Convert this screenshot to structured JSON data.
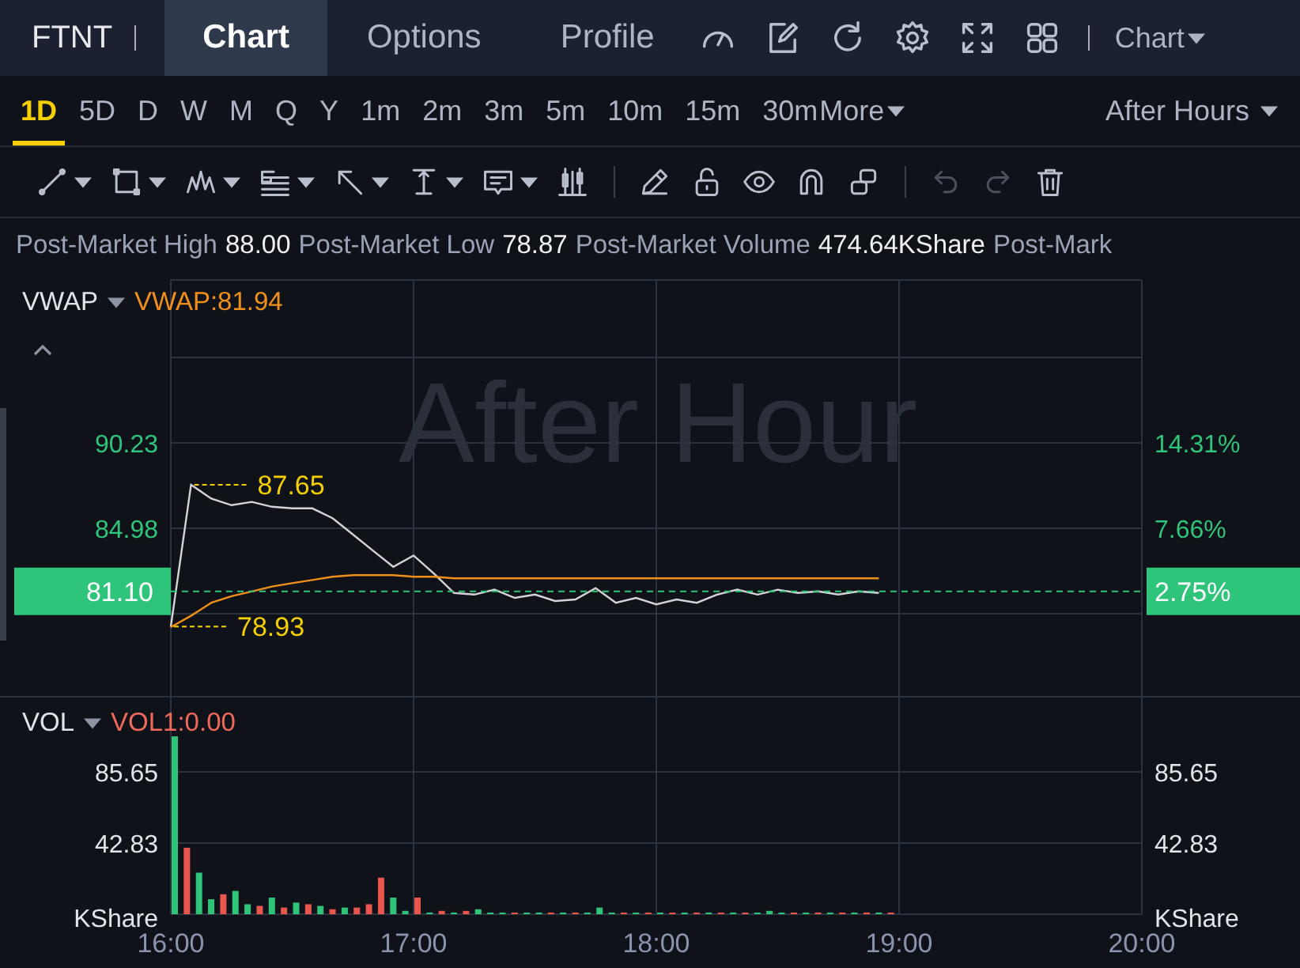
{
  "header": {
    "symbol": "FTNT",
    "tabs": [
      {
        "label": "Chart",
        "selected": true
      },
      {
        "label": "Options",
        "selected": false
      },
      {
        "label": "Profile",
        "selected": false
      }
    ],
    "tools": [
      {
        "kind": "gauge"
      },
      {
        "kind": "edit"
      },
      {
        "kind": "refresh"
      },
      {
        "kind": "settings"
      },
      {
        "kind": "fullscreen"
      },
      {
        "kind": "layout"
      }
    ],
    "chart_menu": "Chart"
  },
  "periods": [
    {
      "label": "1D",
      "selected": true
    },
    {
      "label": "5D",
      "selected": false
    },
    {
      "label": "D",
      "selected": false
    },
    {
      "label": "W",
      "selected": false
    },
    {
      "label": "M",
      "selected": false
    },
    {
      "label": "Q",
      "selected": false
    },
    {
      "label": "Y",
      "selected": false
    },
    {
      "label": "1m",
      "selected": false
    },
    {
      "label": "2m",
      "selected": false
    },
    {
      "label": "3m",
      "selected": false
    },
    {
      "label": "5m",
      "selected": false
    },
    {
      "label": "10m",
      "selected": false
    },
    {
      "label": "15m",
      "selected": false
    },
    {
      "label": "30m",
      "selected": false
    }
  ],
  "more_menu": "More",
  "session_menu": "After Hours",
  "drawing_tools": [
    {
      "kind": "line",
      "menu": true,
      "disabled": false
    },
    {
      "kind": "rectangle",
      "menu": true,
      "disabled": false
    },
    {
      "kind": "pattern",
      "menu": true,
      "disabled": false
    },
    {
      "kind": "fib",
      "menu": true,
      "disabled": false
    },
    {
      "kind": "arrow",
      "menu": true,
      "disabled": false
    },
    {
      "kind": "measure",
      "menu": true,
      "disabled": false
    },
    {
      "kind": "textbox",
      "menu": true,
      "disabled": false
    },
    {
      "kind": "candles",
      "menu": false,
      "disabled": false
    },
    {
      "kind": "divider"
    },
    {
      "kind": "pencil",
      "menu": false,
      "disabled": false
    },
    {
      "kind": "lock",
      "menu": false,
      "disabled": false
    },
    {
      "kind": "eye",
      "menu": false,
      "disabled": false
    },
    {
      "kind": "magnet",
      "menu": false,
      "disabled": false
    },
    {
      "kind": "link",
      "menu": false,
      "disabled": false
    },
    {
      "kind": "divider"
    },
    {
      "kind": "undo",
      "menu": false,
      "disabled": true
    },
    {
      "kind": "redo",
      "menu": false,
      "disabled": true
    },
    {
      "kind": "trash",
      "menu": false,
      "disabled": false
    }
  ],
  "stats": [
    {
      "label": "Post-Market High",
      "value": "88.00"
    },
    {
      "label": "Post-Market Low",
      "value": "78.87"
    },
    {
      "label": "Post-Market Volume",
      "value": "474.64KShare"
    },
    {
      "label": "Post-Mark"
    }
  ],
  "price_pane": {
    "indicator": "VWAP",
    "reading": "VWAP:81.94",
    "watermark": "After Hour",
    "right_axis": [
      "14.31%",
      "7.66%"
    ],
    "last_change": "2.75%",
    "chart_data": {
      "type": "line",
      "categories": [
        null,
        null,
        null,
        null,
        null,
        null,
        null,
        null,
        null,
        null,
        null,
        null,
        null,
        null,
        null,
        null,
        null,
        null,
        null,
        null,
        null,
        null,
        null,
        null,
        null,
        null,
        null,
        null,
        null,
        null,
        null,
        null,
        null,
        null,
        null,
        null,
        null,
        null,
        null,
        null,
        null,
        null,
        null,
        null,
        null,
        null,
        null,
        null,
        null
      ],
      "series": [
        {
          "color": "#d4d4d4",
          "values": [
            78.93,
            87.65,
            86.8,
            86.4,
            86.6,
            86.3,
            86.2,
            86.2,
            85.6,
            84.6,
            83.6,
            82.6,
            83.3,
            82.2,
            81.0,
            80.9,
            81.2,
            80.7,
            80.9,
            80.5,
            80.6,
            81.3,
            80.4,
            80.7,
            80.3,
            80.6,
            80.4,
            80.9,
            81.2,
            80.9,
            81.2,
            81.0,
            81.1,
            80.9,
            81.1,
            81.0,
            null,
            null,
            null,
            null,
            null,
            null,
            null,
            null,
            null,
            null,
            null,
            null,
            null
          ]
        },
        {
          "color": "#f0901a",
          "values": [
            78.9,
            79.6,
            80.4,
            80.8,
            81.1,
            81.4,
            81.6,
            81.8,
            82.0,
            82.1,
            82.1,
            82.1,
            82.0,
            82.0,
            81.9,
            81.9,
            81.9,
            81.9,
            81.9,
            81.9,
            81.9,
            81.9,
            81.9,
            81.9,
            81.9,
            81.9,
            81.9,
            81.9,
            81.9,
            81.9,
            81.9,
            81.9,
            81.9,
            81.9,
            81.9,
            81.9,
            null,
            null,
            null,
            null,
            null,
            null,
            null,
            null,
            null,
            null,
            null,
            null,
            null
          ]
        }
      ],
      "ylim": [
        74.67,
        100.24
      ],
      "grid": true,
      "yticks": [
        {
          "value": 90.23,
          "label": "90.23"
        },
        {
          "value": 84.98,
          "label": "84.98"
        }
      ],
      "ref_lines": [
        {
          "axis": "y",
          "value": 81.1,
          "label": "81.10"
        }
      ],
      "annotations": [
        "87.65",
        "78.93"
      ]
    }
  },
  "volume_pane": {
    "indicator": "VOL",
    "reading": "VOL1:0.00",
    "right_axis": [
      "85.65",
      "42.83",
      "KShare"
    ],
    "chart_data": {
      "type": "bar",
      "ylabel": "KShare",
      "categories": [
        "16:00",
        null,
        null,
        null,
        null,
        null,
        null,
        null,
        null,
        null,
        null,
        null,
        null,
        null,
        null,
        null,
        null,
        null,
        null,
        null,
        "17:00",
        null,
        null,
        null,
        null,
        null,
        null,
        null,
        null,
        null,
        null,
        null,
        null,
        null,
        null,
        null,
        null,
        null,
        null,
        null,
        "18:00",
        null,
        null,
        null,
        null,
        null,
        null,
        null,
        null,
        null,
        null,
        null,
        null,
        null,
        null,
        null,
        null,
        null,
        null,
        null,
        "19:00",
        null,
        null,
        null,
        null,
        null,
        null,
        null,
        null,
        null,
        null,
        null,
        null,
        null,
        null,
        null,
        null,
        null,
        null,
        null,
        "20:00"
      ],
      "series": [
        {
          "color": "#2ec47a",
          "values": [
            107,
            null,
            25,
            9,
            null,
            14,
            6,
            null,
            10,
            null,
            7,
            null,
            5,
            null,
            4,
            null,
            null,
            null,
            10,
            2,
            null,
            1,
            null,
            1,
            null,
            3,
            1,
            1,
            null,
            1,
            1,
            null,
            1,
            null,
            1,
            4,
            1,
            null,
            1,
            null,
            1,
            null,
            1,
            null,
            1,
            null,
            1,
            null,
            1,
            2,
            1,
            null,
            1,
            null,
            1,
            null,
            1,
            null,
            1,
            null,
            null,
            null,
            null,
            null,
            null,
            null,
            null,
            null,
            null,
            null,
            null,
            null,
            null,
            null,
            null,
            null,
            null,
            null,
            null,
            null,
            null
          ]
        },
        {
          "color": "#e8564e",
          "values": [
            null,
            40,
            null,
            null,
            12,
            null,
            null,
            5,
            null,
            4,
            null,
            6,
            null,
            3,
            null,
            4,
            6,
            22,
            null,
            null,
            10,
            null,
            2,
            null,
            2,
            null,
            null,
            null,
            1,
            null,
            null,
            1,
            null,
            1,
            null,
            null,
            null,
            1,
            null,
            1,
            null,
            1,
            null,
            1,
            null,
            1,
            null,
            1,
            null,
            null,
            null,
            1,
            null,
            1,
            null,
            1,
            null,
            1,
            null,
            1,
            null,
            null,
            null,
            null,
            null,
            null,
            null,
            null,
            null,
            null,
            null,
            null,
            null,
            null,
            null,
            null,
            null,
            null,
            null,
            null,
            null
          ]
        }
      ],
      "ylim": [
        0,
        131.3
      ],
      "grid": true,
      "yticks": [
        {
          "value": 85.65,
          "label": "85.65"
        },
        {
          "value": 42.83,
          "label": "42.83"
        }
      ]
    }
  }
}
